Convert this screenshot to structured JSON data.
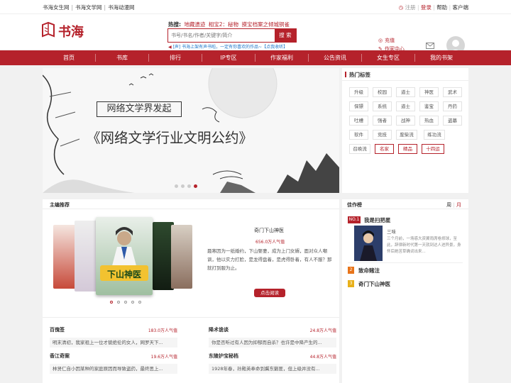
{
  "topbar": {
    "sites": [
      "书海女生网",
      "书海文学网",
      "书海动漫网"
    ],
    "register": "注册",
    "login": "登录",
    "help": "帮助",
    "client": "客户端"
  },
  "header": {
    "logo_text": "书海",
    "hot_label": "热搜:",
    "hot_items": [
      "地藏遗迹",
      "相宝2：秘物",
      "摸宝档案之倾城铜雀"
    ],
    "search_placeholder": "书号/书名/作者/关键字/简介",
    "search_button": "搜 索",
    "notice": "[声] 书海上架有声书啦，一定有你喜欢的作品~【点我收听】",
    "recharge": "充值",
    "author_center": "作家中心"
  },
  "nav": [
    "首页",
    "书库",
    "排行",
    "IP专区",
    "作家福利",
    "公告资讯",
    "女生专区",
    "我的书架"
  ],
  "banner": {
    "line1": "网络文学界发起",
    "line2": "《网络文学行业文明公约》"
  },
  "tags": {
    "title": "热门标签",
    "rows": [
      [
        "升级",
        "校园",
        "道士",
        "神医",
        "武术"
      ],
      [
        "保镖",
        "系统",
        "道士",
        "鉴宝",
        "丹药"
      ],
      [
        "吐槽",
        "强者",
        "战神",
        "热血",
        "盗墓"
      ],
      [
        "软件",
        "竞技",
        "废柴流",
        "练功流"
      ],
      [
        "召唤流",
        "名家",
        "精品",
        "十四运"
      ]
    ],
    "highlight": [
      "名家",
      "精品",
      "十四运"
    ]
  },
  "recommend": {
    "title": "主编推荐",
    "featured": {
      "name": "奇门下山神医",
      "views": "656.0万人气值",
      "desc": "聂寒因为一纸婚约，下山娶妻，成为上门女婿，面对众人嘲讽，他以实力打脸，是龙得盘着，是虎得卧着，有人不服？那就打到服为止。",
      "read_button": "点击阅读"
    },
    "cover_texts": [
      "下山神医"
    ],
    "list": [
      {
        "name": "百傀签",
        "views": "183.0万人气值",
        "desc": "明末清初，我家祖上一位才貌绝伦的女人，网罗天下..."
      },
      {
        "name": "降术诡谈",
        "views": "24.8万人气值",
        "desc": "你是否听过有人因为抑郁而自杀？也许是中降产生的..."
      },
      {
        "name": "香江奇案",
        "views": "19.6万人气值",
        "desc": "林贤仁自小因某种的家庭原因而导致盗药，最终思上..."
      },
      {
        "name": "东陵护宝秘档",
        "views": "44.8万人气值",
        "desc": "1928年春，孙殿英奉命到冀东剿匪，但上级并没有..."
      }
    ]
  },
  "rank": {
    "title": "佳作榜",
    "tab_week": "周",
    "tab_sep": "|",
    "tab_month": "月",
    "items": [
      {
        "num": "NO.1",
        "name": "我是扫把星",
        "author": "三味",
        "desc": "三个月前，一场惑大资翼雨席卷烦球，至此，辞律新时代第一天就到达人进异景，身怀后她苦草确词出来..."
      },
      {
        "num": "2",
        "name": "致命赌注"
      },
      {
        "num": "3",
        "name": "奇门下山神医"
      }
    ]
  },
  "colors": {
    "brand": "#b5222b",
    "rank2": "#e8741a",
    "rank3": "#e8b01a"
  }
}
